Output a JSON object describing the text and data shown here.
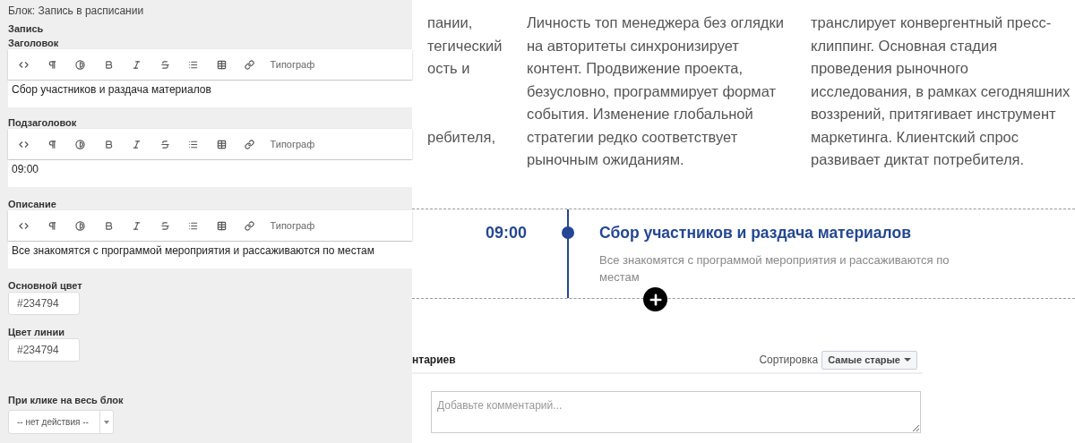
{
  "panel": {
    "title": "Блок: Запись в расписании",
    "section": "Запись",
    "editors": [
      {
        "label": "Заголовок",
        "toolbar": [
          {
            "kind": "code"
          },
          {
            "kind": "pilcrow"
          },
          {
            "kind": "contrast"
          },
          {
            "kind": "bold"
          },
          {
            "kind": "italic"
          },
          {
            "kind": "strike"
          },
          {
            "kind": "list"
          },
          {
            "kind": "table"
          },
          {
            "kind": "link"
          },
          {
            "kind": "text",
            "label": "Типограф"
          }
        ],
        "value": "Сбор участников и раздача материалов"
      },
      {
        "label": "Подзаголовок",
        "toolbar": [
          {
            "kind": "code"
          },
          {
            "kind": "pilcrow"
          },
          {
            "kind": "contrast"
          },
          {
            "kind": "bold"
          },
          {
            "kind": "italic"
          },
          {
            "kind": "strike"
          },
          {
            "kind": "list"
          },
          {
            "kind": "table"
          },
          {
            "kind": "link"
          },
          {
            "kind": "text",
            "label": "Типограф"
          }
        ],
        "value": "09:00"
      },
      {
        "label": "Описание",
        "toolbar": [
          {
            "kind": "code"
          },
          {
            "kind": "pilcrow"
          },
          {
            "kind": "contrast"
          },
          {
            "kind": "bold"
          },
          {
            "kind": "italic"
          },
          {
            "kind": "strike"
          },
          {
            "kind": "list"
          },
          {
            "kind": "table"
          },
          {
            "kind": "link"
          },
          {
            "kind": "text",
            "label": "Типограф"
          }
        ],
        "value": "Все знакомятся с программой мероприятия и рассаживаются по местам"
      }
    ],
    "colors": [
      {
        "label": "Основной цвет",
        "value": "#234794"
      },
      {
        "label": "Цвет линии",
        "value": "#234794"
      }
    ],
    "click_action": {
      "label": "При клике на весь блок",
      "value": "-- нет действия --"
    }
  },
  "page": {
    "column_1": [
      [
        "пании,",
        "тегический",
        "ость и"
      ],
      [
        "ребителя,"
      ]
    ],
    "column_2": [
      "Личность топ менеджера без оглядки",
      "на авторитеты синхронизирует",
      "контент. Продвижение проекта,",
      "безусловно, программирует формат",
      "события. Изменение глобальной",
      "стратегии редко соответствует",
      "рыночным ожиданиям."
    ],
    "column_3": [
      "транслирует конвергентный пресс-",
      "клиппинг. Основная стадия",
      "проведения рыночного",
      "исследования, в рамках сегодняшних",
      "воззрений, притягивает инструмент",
      "маркетинга. Клиентский спрос",
      "развивает диктат потребителя."
    ],
    "schedule": {
      "time": "09:00",
      "title": "Сбор участников и раздача материалов",
      "description": "Все знакомятся с программой мероприятия и рассаживаются по местам"
    },
    "comments": {
      "count_label": "нтариев",
      "sort_label": "Сортировка",
      "sort_value": "Самые старые",
      "placeholder": "Добавьте комментарий..."
    }
  }
}
